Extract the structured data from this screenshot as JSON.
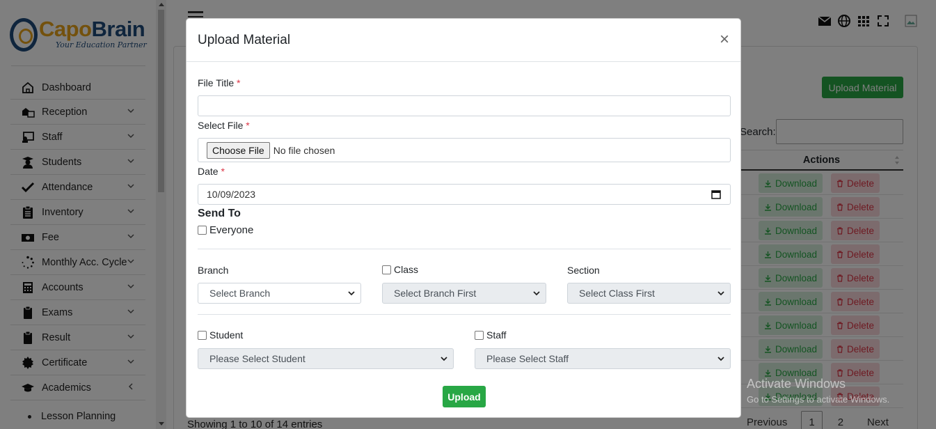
{
  "brand": {
    "name_part1": "Capo",
    "name_part2": "Brain",
    "tagline": "Your Education Partner"
  },
  "sidebar": {
    "items": [
      {
        "label": "Dashboard",
        "icon": "home-icon",
        "has_children": false
      },
      {
        "label": "Reception",
        "icon": "reception-icon",
        "has_children": true
      },
      {
        "label": "Staff",
        "icon": "staff-icon",
        "has_children": true
      },
      {
        "label": "Students",
        "icon": "students-icon",
        "has_children": true
      },
      {
        "label": "Attendance",
        "icon": "check-icon",
        "has_children": true
      },
      {
        "label": "Inventory",
        "icon": "inventory-icon",
        "has_children": true
      },
      {
        "label": "Fee",
        "icon": "money-icon",
        "has_children": true
      },
      {
        "label": "Monthly Acc. Cycle",
        "icon": "spinner-icon",
        "has_children": true
      },
      {
        "label": "Accounts",
        "icon": "calculator-icon",
        "has_children": true
      },
      {
        "label": "Exams",
        "icon": "clipboard-icon",
        "has_children": true
      },
      {
        "label": "Result",
        "icon": "clipboard-icon",
        "has_children": true
      },
      {
        "label": "Certificate",
        "icon": "certificate-icon",
        "has_children": true
      },
      {
        "label": "Academics",
        "icon": "graduation-cap-icon",
        "has_children": true,
        "expanded": true
      }
    ],
    "sub_items": [
      {
        "label": "Lesson Planning"
      }
    ]
  },
  "main": {
    "upload_button": "Upload Material",
    "search_label": "Search:",
    "actions_header": "Actions",
    "row_actions": {
      "download": "Download",
      "delete": "Delete"
    },
    "row_count": 10,
    "footer_info": "Showing 1 to 10 of 14 entries",
    "pagination": {
      "previous": "Previous",
      "pages": [
        "1",
        "2"
      ],
      "next": "Next",
      "current": "1"
    }
  },
  "modal": {
    "title": "Upload Material",
    "close": "×",
    "file_title_label": "File Title",
    "file_title_value": "",
    "select_file_label": "Select File",
    "choose_file_button": "Choose File",
    "no_file_text": "No file chosen",
    "date_label": "Date",
    "date_value": "10/09/2023",
    "required_mark": "*",
    "send_to_label": "Send To",
    "everyone_label": "Everyone",
    "branch_label": "Branch",
    "class_label": "Class",
    "section_label": "Section",
    "branch_select": "Select Branch",
    "class_select": "Select Branch First",
    "section_select": "Select Class First",
    "student_label": "Student",
    "staff_label": "Staff",
    "student_select": "Please Select Student",
    "staff_select": "Please Select Staff",
    "upload_button": "Upload"
  },
  "watermark": {
    "line1": "Activate Windows",
    "line2": "Go to Settings to activate Windows."
  },
  "colors": {
    "success": "#28a745",
    "danger": "#dc3545",
    "brand_gold": "#e6a21a",
    "brand_blue": "#1f4a7a"
  }
}
